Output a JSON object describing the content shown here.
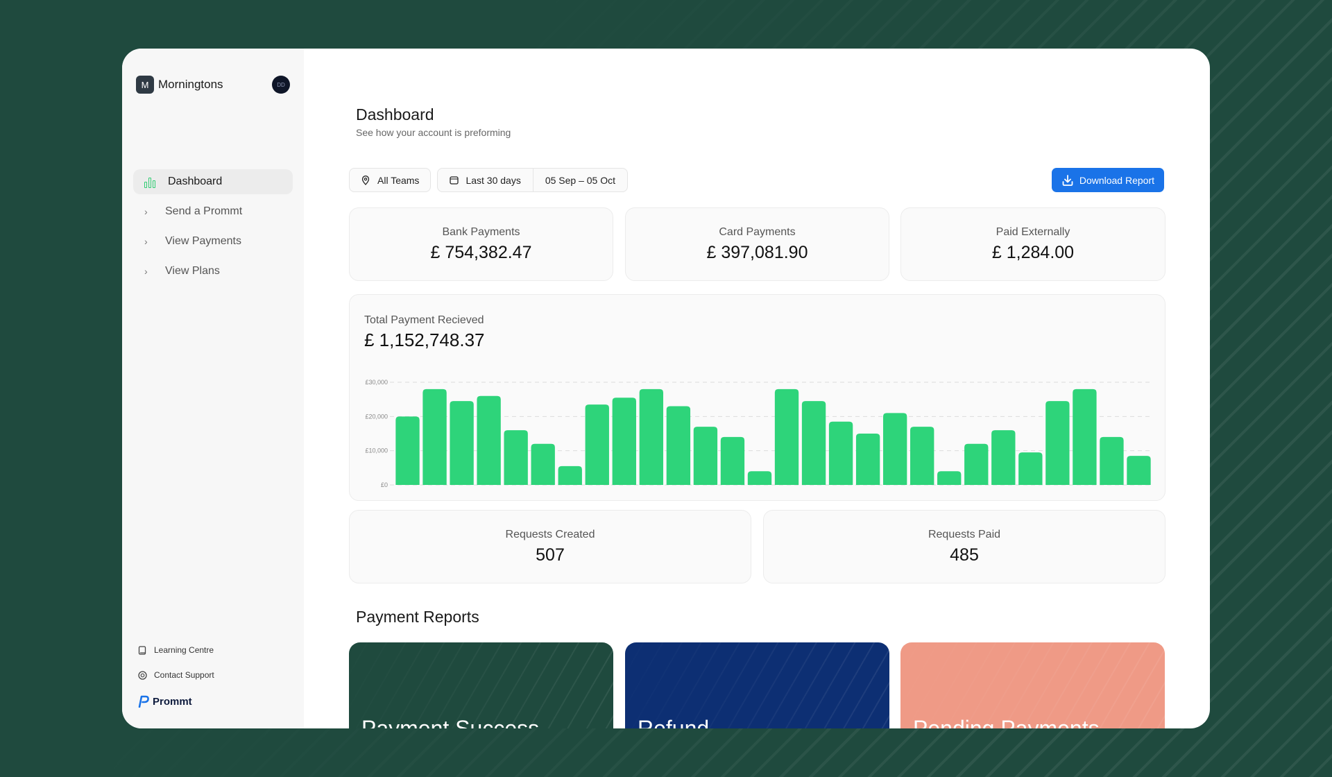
{
  "sidebar": {
    "brand_initial": "M",
    "brand_name": "Morningtons",
    "avatar_initials": "DD",
    "nav": [
      {
        "label": "Dashboard",
        "icon": "bar-chart-icon",
        "active": true
      },
      {
        "label": "Send a Prommt",
        "icon": "chevron-right-icon"
      },
      {
        "label": "View Payments",
        "icon": "chevron-right-icon"
      },
      {
        "label": "View Plans",
        "icon": "chevron-right-icon"
      }
    ],
    "footer": [
      {
        "label": "Learning Centre",
        "icon": "book-icon"
      },
      {
        "label": "Contact Support",
        "icon": "support-icon"
      }
    ],
    "product_logo": "Prommt"
  },
  "header": {
    "title": "Dashboard",
    "subtitle": "See how your account is preforming"
  },
  "filters": {
    "team": "All Teams",
    "period": "Last 30 days",
    "date_range": "05 Sep – 05 Oct"
  },
  "actions": {
    "download": "Download Report"
  },
  "stats": {
    "bank": {
      "label": "Bank Payments",
      "value": "£ 754,382.47"
    },
    "card": {
      "label": "Card Payments",
      "value": "£ 397,081.90"
    },
    "external": {
      "label": "Paid Externally",
      "value": "£ 1,284.00"
    }
  },
  "total": {
    "label": "Total Payment Recieved",
    "value": "£ 1,152,748.37"
  },
  "requests": {
    "created": {
      "label": "Requests Created",
      "value": "507"
    },
    "paid": {
      "label": "Requests Paid",
      "value": "485"
    }
  },
  "reports": {
    "title": "Payment Reports",
    "cards": [
      {
        "label": "Payment Success",
        "color": "#1f4a3e"
      },
      {
        "label": "Refund",
        "color": "#0d2f73"
      },
      {
        "label": "Pending Payments",
        "color": "#ef9a86"
      }
    ]
  },
  "colors": {
    "accent": "#1a73e8",
    "bar": "#2ed47a",
    "background": "#1f4a3e"
  },
  "chart_data": {
    "type": "bar",
    "categories": [],
    "values": [
      20000,
      28000,
      24500,
      26000,
      16000,
      12000,
      5500,
      23500,
      25500,
      28000,
      23000,
      17000,
      14000,
      4000,
      28000,
      24500,
      18500,
      15000,
      21000,
      17000,
      4000,
      12000,
      16000,
      9500,
      24500,
      28000,
      14000,
      8500
    ],
    "ylim": [
      0,
      30000
    ],
    "yticks": [
      {
        "value": 30000,
        "label": "£30,000"
      },
      {
        "value": 20000,
        "label": "£20,000"
      },
      {
        "value": 10000,
        "label": "£10,000"
      },
      {
        "value": 0,
        "label": "£0"
      }
    ],
    "grid": true,
    "title": "Total Payment Recieved"
  }
}
